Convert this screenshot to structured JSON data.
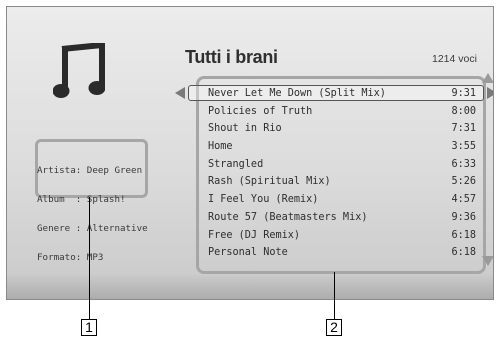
{
  "screen": {
    "title": "Tutti i brani",
    "item_count": "1214 voci",
    "icon": "music-note-icon"
  },
  "metadata": {
    "lines": [
      "Artista: Deep Green",
      "Album  : Splash!",
      "Genere : Alternative",
      "Formato: MP3"
    ]
  },
  "tracks": [
    {
      "name": "Never Let Me Down (Split Mix)",
      "duration": "9:31",
      "selected": true
    },
    {
      "name": "Policies of Truth",
      "duration": "8:00"
    },
    {
      "name": "Shout in Rio",
      "duration": "7:31"
    },
    {
      "name": "Home",
      "duration": "3:55"
    },
    {
      "name": "Strangled",
      "duration": "6:33"
    },
    {
      "name": "Rash (Spiritual Mix)",
      "duration": "5:26"
    },
    {
      "name": "I Feel You (Remix)",
      "duration": "4:57"
    },
    {
      "name": "Route 57 (Beatmasters Mix)",
      "duration": "9:36"
    },
    {
      "name": "Free (DJ Remix)",
      "duration": "6:18"
    },
    {
      "name": "Personal Note",
      "duration": "6:18"
    }
  ],
  "callouts": [
    "1",
    "2"
  ]
}
